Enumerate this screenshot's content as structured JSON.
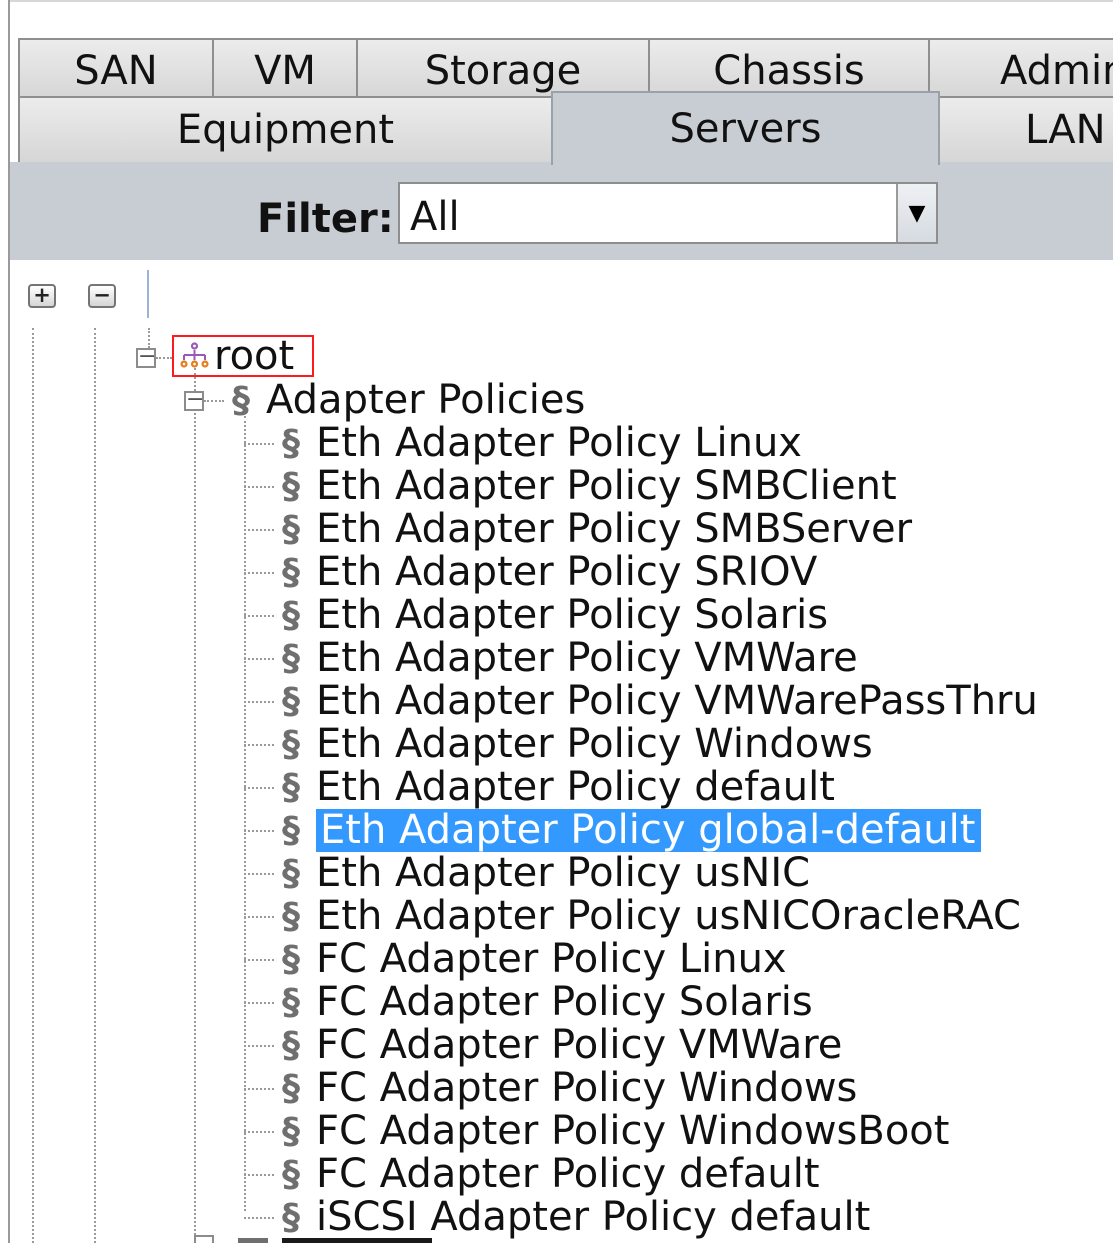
{
  "tabs": {
    "top_row": [
      {
        "label": "SAN"
      },
      {
        "label": "VM"
      },
      {
        "label": "Storage"
      },
      {
        "label": "Chassis"
      },
      {
        "label": "Admin"
      }
    ],
    "bottom_row": [
      {
        "label": "Equipment"
      },
      {
        "label": "Servers"
      },
      {
        "label": "LAN"
      }
    ]
  },
  "filter": {
    "label": "Filter:",
    "value": "All"
  },
  "tree": {
    "root_label": "root",
    "group_label": "Adapter Policies",
    "items": [
      "Eth Adapter Policy Linux",
      "Eth Adapter Policy SMBClient",
      "Eth Adapter Policy SMBServer",
      "Eth Adapter Policy SRIOV",
      "Eth Adapter Policy Solaris",
      "Eth Adapter Policy VMWare",
      "Eth Adapter Policy VMWarePassThru",
      "Eth Adapter Policy Windows",
      "Eth Adapter Policy default",
      "Eth Adapter Policy global-default",
      "Eth Adapter Policy usNIC",
      "Eth Adapter Policy usNICOracleRAC",
      "FC Adapter Policy Linux",
      "FC Adapter Policy Solaris",
      "FC Adapter Policy VMWare",
      "FC Adapter Policy Windows",
      "FC Adapter Policy WindowsBoot",
      "FC Adapter Policy default",
      "iSCSI Adapter Policy default"
    ],
    "selected_item": "Eth Adapter Policy global-default"
  },
  "icons": {
    "root": "org-tree-icon",
    "policy": "policy-scroll-icon",
    "expand_all": "expand-all-icon",
    "collapse_all": "collapse-all-icon"
  },
  "colors": {
    "selection": "#3399ff",
    "highlight_border": "#ff1b1b",
    "panel": "#c7cdd2"
  }
}
